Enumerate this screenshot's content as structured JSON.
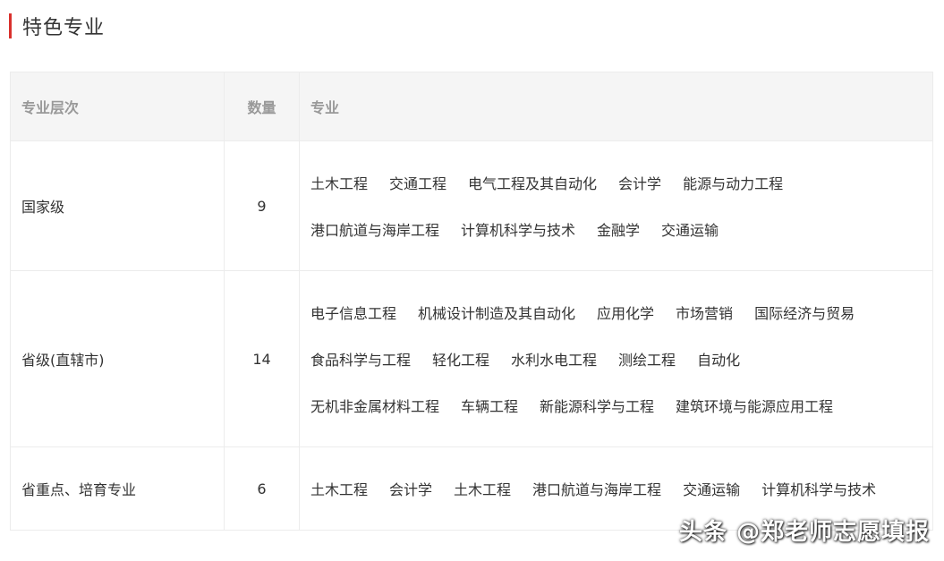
{
  "section": {
    "title": "特色专业",
    "accent_color": "#d9302c"
  },
  "table": {
    "headers": {
      "level": "专业层次",
      "count": "数量",
      "majors": "专业"
    },
    "rows": [
      {
        "level": "国家级",
        "count": "9",
        "lines": [
          [
            "土木工程",
            "交通工程",
            "电气工程及其自动化",
            "会计学",
            "能源与动力工程"
          ],
          [
            "港口航道与海岸工程",
            "计算机科学与技术",
            "金融学",
            "交通运输"
          ]
        ]
      },
      {
        "level": "省级(直辖市)",
        "count": "14",
        "lines": [
          [
            "电子信息工程",
            "机械设计制造及其自动化",
            "应用化学",
            "市场营销",
            "国际经济与贸易"
          ],
          [
            "食品科学与工程",
            "轻化工程",
            "水利水电工程",
            "测绘工程",
            "自动化"
          ],
          [
            "无机非金属材料工程",
            "车辆工程",
            "新能源科学与工程",
            "建筑环境与能源应用工程"
          ]
        ]
      },
      {
        "level": "省重点、培育专业",
        "count": "6",
        "lines": [
          [
            "土木工程",
            "会计学",
            "土木工程",
            "港口航道与海岸工程",
            "交通运输",
            "计算机科学与技术"
          ]
        ]
      }
    ]
  },
  "watermark": {
    "text": "头条 @郑老师志愿填报"
  }
}
